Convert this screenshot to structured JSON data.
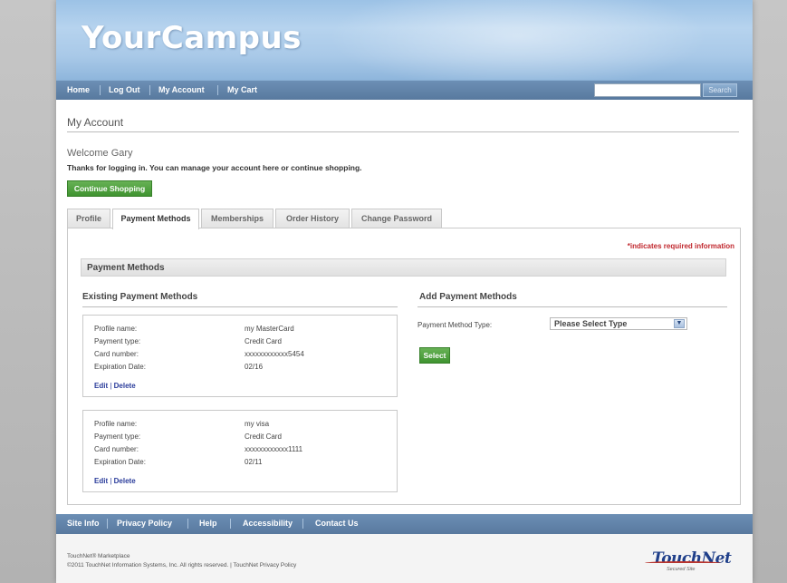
{
  "brand": {
    "logo_text": "YourCampus"
  },
  "nav": {
    "items": [
      "Home",
      "Log Out",
      "My Account",
      "My Cart"
    ],
    "search_button": "Search",
    "search_value": ""
  },
  "page": {
    "title": "My Account",
    "welcome": "Welcome Gary",
    "thanks": "Thanks for logging in. You can manage your account here or continue shopping.",
    "continue_button": "Continue Shopping"
  },
  "tabs": [
    {
      "label": "Profile",
      "active": false
    },
    {
      "label": "Payment Methods",
      "active": true
    },
    {
      "label": "Memberships",
      "active": false
    },
    {
      "label": "Order History",
      "active": false
    },
    {
      "label": "Change Password",
      "active": false
    }
  ],
  "panel": {
    "required_note": "*indicates required information",
    "section_title": "Payment Methods",
    "existing_title": "Existing Payment Methods",
    "add_title": "Add Payment Methods",
    "field_labels": {
      "profile_name": "Profile name:",
      "payment_type": "Payment type:",
      "card_number": "Card number:",
      "expiration": "Expiration Date:"
    },
    "cards": [
      {
        "profile_name": "my MasterCard",
        "payment_type": "Credit Card",
        "card_number": "xxxxxxxxxxxx5454",
        "expiration": "02/16",
        "edit": "Edit",
        "delete": "Delete",
        "sep": "|"
      },
      {
        "profile_name": "my visa",
        "payment_type": "Credit Card",
        "card_number": "xxxxxxxxxxxx1111",
        "expiration": "02/11",
        "edit": "Edit",
        "delete": "Delete",
        "sep": "|"
      }
    ],
    "add": {
      "type_label": "Payment Method Type:",
      "type_selected": "Please Select Type",
      "select_button": "Select"
    }
  },
  "footer": {
    "links": [
      "Site Info",
      "Privacy Policy",
      "Help",
      "Accessibility",
      "Contact Us"
    ],
    "line1": "TouchNet® Marketplace",
    "line2": "©2011 TouchNet Information Systems, Inc. All rights reserved. | TouchNet Privacy Policy",
    "logo_brand": "TouchNet",
    "logo_tag": "Secured Site"
  },
  "colors": {
    "header": "#a9c9e8",
    "navbar": "#6c8fb5",
    "green_button": "#4a9b3a",
    "link": "#2a3c9b",
    "required": "#c0272d"
  }
}
